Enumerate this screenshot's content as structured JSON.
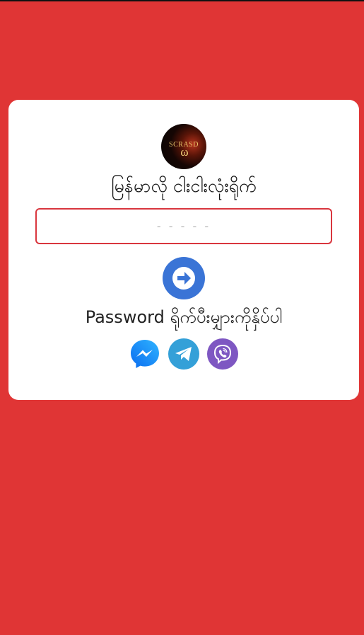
{
  "brand": {
    "logo_text": "SCRASD",
    "logo_glyph": "ω"
  },
  "card": {
    "title": "မြန်မာလို ငါးငါးလုံးရိုက်",
    "input_value": "",
    "input_placeholder": "- - - - -",
    "submit_icon": "arrow-right-icon",
    "hint": "Password ရိုက်ပီးမျှားကိုနှိပ်ပါ"
  },
  "social": [
    {
      "name": "messenger",
      "icon": "messenger-icon",
      "color": "#1e8cf3"
    },
    {
      "name": "telegram",
      "icon": "telegram-icon",
      "color": "#34a0d8"
    },
    {
      "name": "viber",
      "icon": "viber-icon",
      "color": "#7e57c2"
    }
  ],
  "colors": {
    "background": "#e03535",
    "card": "#ffffff",
    "accent": "#3a74d6",
    "input_border": "#d9363e"
  }
}
